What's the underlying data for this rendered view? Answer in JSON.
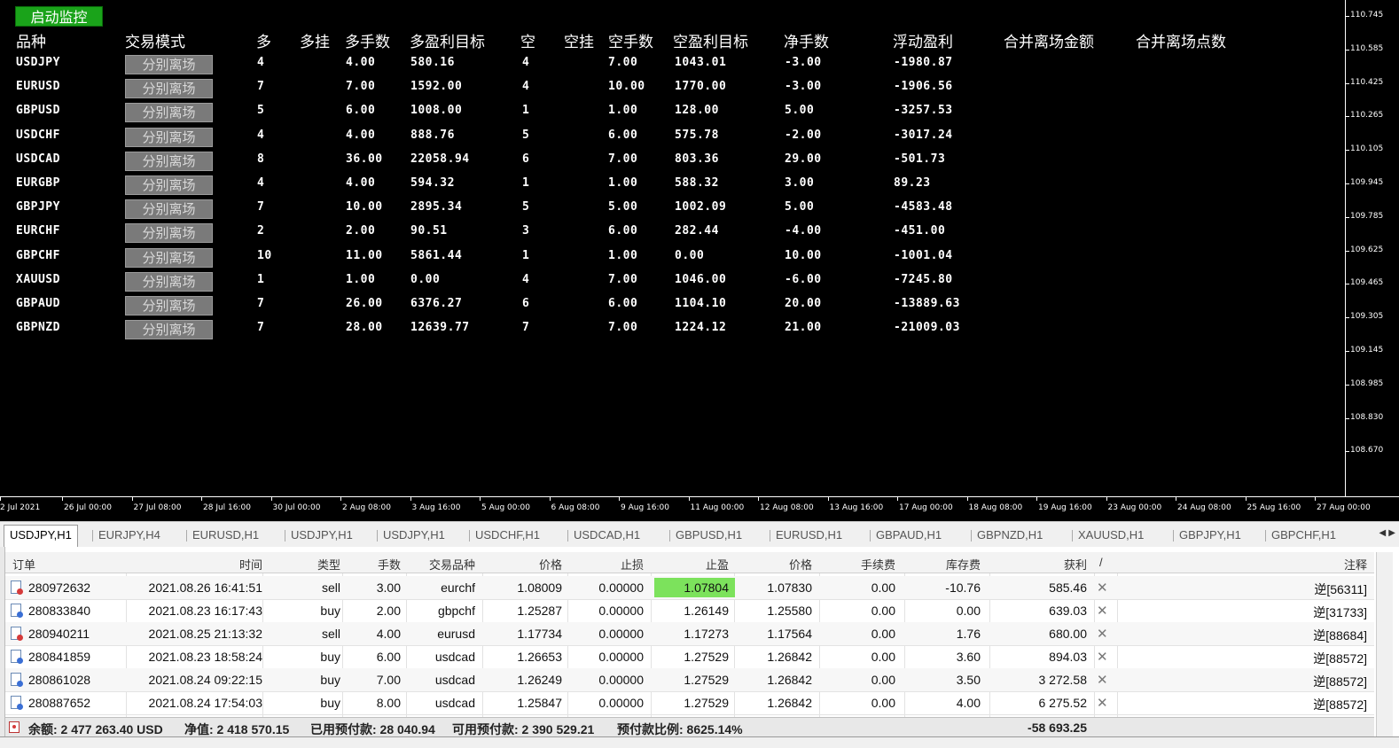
{
  "start_button": "启动监控",
  "headers": {
    "symbol": "品种",
    "mode": "交易模式",
    "long": "多",
    "long_pending": "多挂",
    "long_lots": "多手数",
    "long_tp_target": "多盈利目标",
    "short": "空",
    "short_pending": "空挂",
    "short_lots": "空手数",
    "short_tp_target": "空盈利目标",
    "net_lots": "净手数",
    "floating_pl": "浮动盈利",
    "merged_exit_amount": "合并离场金额",
    "merged_exit_points": "合并离场点数"
  },
  "rows": [
    {
      "symbol": "USDJPY",
      "mode": "分别离场",
      "long": "4",
      "long_lots": "4.00",
      "long_tp": "580.16",
      "short": "4",
      "short_lots": "7.00",
      "short_tp": "1043.01",
      "net": "-3.00",
      "pl": "-1980.87"
    },
    {
      "symbol": "EURUSD",
      "mode": "分别离场",
      "long": "7",
      "long_lots": "7.00",
      "long_tp": "1592.00",
      "short": "4",
      "short_lots": "10.00",
      "short_tp": "1770.00",
      "net": "-3.00",
      "pl": "-1906.56"
    },
    {
      "symbol": "GBPUSD",
      "mode": "分别离场",
      "long": "5",
      "long_lots": "6.00",
      "long_tp": "1008.00",
      "short": "1",
      "short_lots": "1.00",
      "short_tp": "128.00",
      "net": "5.00",
      "pl": "-3257.53"
    },
    {
      "symbol": "USDCHF",
      "mode": "分别离场",
      "long": "4",
      "long_lots": "4.00",
      "long_tp": "888.76",
      "short": "5",
      "short_lots": "6.00",
      "short_tp": "575.78",
      "net": "-2.00",
      "pl": "-3017.24"
    },
    {
      "symbol": "USDCAD",
      "mode": "分别离场",
      "long": "8",
      "long_lots": "36.00",
      "long_tp": "22058.94",
      "short": "6",
      "short_lots": "7.00",
      "short_tp": "803.36",
      "net": "29.00",
      "pl": "-501.73"
    },
    {
      "symbol": "EURGBP",
      "mode": "分别离场",
      "long": "4",
      "long_lots": "4.00",
      "long_tp": "594.32",
      "short": "1",
      "short_lots": "1.00",
      "short_tp": "588.32",
      "net": "3.00",
      "pl": "89.23"
    },
    {
      "symbol": "GBPJPY",
      "mode": "分别离场",
      "long": "7",
      "long_lots": "10.00",
      "long_tp": "2895.34",
      "short": "5",
      "short_lots": "5.00",
      "short_tp": "1002.09",
      "net": "5.00",
      "pl": "-4583.48"
    },
    {
      "symbol": "EURCHF",
      "mode": "分别离场",
      "long": "2",
      "long_lots": "2.00",
      "long_tp": "90.51",
      "short": "3",
      "short_lots": "6.00",
      "short_tp": "282.44",
      "net": "-4.00",
      "pl": "-451.00"
    },
    {
      "symbol": "GBPCHF",
      "mode": "分别离场",
      "long": "10",
      "long_lots": "11.00",
      "long_tp": "5861.44",
      "short": "1",
      "short_lots": "1.00",
      "short_tp": "0.00",
      "net": "10.00",
      "pl": "-1001.04"
    },
    {
      "symbol": "XAUUSD",
      "mode": "分别离场",
      "long": "1",
      "long_lots": "1.00",
      "long_tp": "0.00",
      "short": "4",
      "short_lots": "7.00",
      "short_tp": "1046.00",
      "net": "-6.00",
      "pl": "-7245.80"
    },
    {
      "symbol": "GBPAUD",
      "mode": "分别离场",
      "long": "7",
      "long_lots": "26.00",
      "long_tp": "6376.27",
      "short": "6",
      "short_lots": "6.00",
      "short_tp": "1104.10",
      "net": "20.00",
      "pl": "-13889.63"
    },
    {
      "symbol": "GBPNZD",
      "mode": "分别离场",
      "long": "7",
      "long_lots": "28.00",
      "long_tp": "12639.77",
      "short": "7",
      "short_lots": "7.00",
      "short_tp": "1224.12",
      "net": "21.00",
      "pl": "-21009.03"
    }
  ],
  "price_axis": [
    "110.745",
    "110.585",
    "110.425",
    "110.265",
    "110.105",
    "109.945",
    "109.785",
    "109.625",
    "109.465",
    "109.305",
    "109.145",
    "108.985",
    "108.830",
    "108.670"
  ],
  "time_axis": [
    "2 Jul 2021",
    "26 Jul 00:00",
    "27 Jul 08:00",
    "28 Jul 16:00",
    "30 Jul 00:00",
    "2 Aug 08:00",
    "3 Aug 16:00",
    "5 Aug 00:00",
    "6 Aug 08:00",
    "9 Aug 16:00",
    "11 Aug 00:00",
    "12 Aug 08:00",
    "13 Aug 16:00",
    "17 Aug 00:00",
    "18 Aug 08:00",
    "19 Aug 16:00",
    "23 Aug 00:00",
    "24 Aug 08:00",
    "25 Aug 16:00",
    "27 Aug 00:00"
  ],
  "chart_tabs": [
    "USDJPY,H1",
    "EURJPY,H4",
    "EURUSD,H1",
    "USDJPY,H1",
    "USDJPY,H1",
    "USDCHF,H1",
    "USDCAD,H1",
    "GBPUSD,H1",
    "EURUSD,H1",
    "GBPAUD,H1",
    "GBPNZD,H1",
    "XAUUSD,H1",
    "GBPJPY,H1",
    "GBPCHF,H1"
  ],
  "tab_scroll_icon": "scroll-arrows-icon",
  "orders_headers": {
    "order": "订单",
    "time": "时间",
    "type": "类型",
    "lots": "手数",
    "symbol": "交易品种",
    "price": "价格",
    "sl": "止损",
    "tp": "止盈",
    "cur_price": "价格",
    "commission": "手续费",
    "swap": "库存费",
    "profit": "获利",
    "sort": "/",
    "comment": "注释"
  },
  "orders": [
    {
      "order": "280972632",
      "time": "2021.08.26 16:41:51",
      "type": "sell",
      "lots": "3.00",
      "symbol": "eurchf",
      "price": "1.08009",
      "sl": "0.00000",
      "tp": "1.07804",
      "cur": "1.07830",
      "commission": "0.00",
      "swap": "-10.76",
      "profit": "585.46",
      "comment": "逆[56311]",
      "tp_hl": true
    },
    {
      "order": "280833840",
      "time": "2021.08.23 16:17:43",
      "type": "buy",
      "lots": "2.00",
      "symbol": "gbpchf",
      "price": "1.25287",
      "sl": "0.00000",
      "tp": "1.26149",
      "cur": "1.25580",
      "commission": "0.00",
      "swap": "0.00",
      "profit": "639.03",
      "comment": "逆[31733]",
      "tp_hl": false
    },
    {
      "order": "280940211",
      "time": "2021.08.25 21:13:32",
      "type": "sell",
      "lots": "4.00",
      "symbol": "eurusd",
      "price": "1.17734",
      "sl": "0.00000",
      "tp": "1.17273",
      "cur": "1.17564",
      "commission": "0.00",
      "swap": "1.76",
      "profit": "680.00",
      "comment": "逆[88684]",
      "tp_hl": false
    },
    {
      "order": "280841859",
      "time": "2021.08.23 18:58:24",
      "type": "buy",
      "lots": "6.00",
      "symbol": "usdcad",
      "price": "1.26653",
      "sl": "0.00000",
      "tp": "1.27529",
      "cur": "1.26842",
      "commission": "0.00",
      "swap": "3.60",
      "profit": "894.03",
      "comment": "逆[88572]",
      "tp_hl": false
    },
    {
      "order": "280861028",
      "time": "2021.08.24 09:22:15",
      "type": "buy",
      "lots": "7.00",
      "symbol": "usdcad",
      "price": "1.26249",
      "sl": "0.00000",
      "tp": "1.27529",
      "cur": "1.26842",
      "commission": "0.00",
      "swap": "3.50",
      "profit": "3 272.58",
      "comment": "逆[88572]",
      "tp_hl": false
    },
    {
      "order": "280887652",
      "time": "2021.08.24 17:54:03",
      "type": "buy",
      "lots": "8.00",
      "symbol": "usdcad",
      "price": "1.25847",
      "sl": "0.00000",
      "tp": "1.27529",
      "cur": "1.26842",
      "commission": "0.00",
      "swap": "4.00",
      "profit": "6 275.52",
      "comment": "逆[88572]",
      "tp_hl": false
    }
  ],
  "summary": {
    "balance": "余额: 2 477 263.40 USD",
    "equity": "净值: 2 418 570.15",
    "margin": "已用预付款: 28 040.94",
    "free_margin": "可用预付款: 2 390 529.21",
    "margin_level": "预付款比例: 8625.14%",
    "total_profit": "-58 693.25"
  },
  "colors": {
    "accent_green": "#1aa31a",
    "tp_highlight": "#7ce25c",
    "chart_bg": "#000000"
  }
}
